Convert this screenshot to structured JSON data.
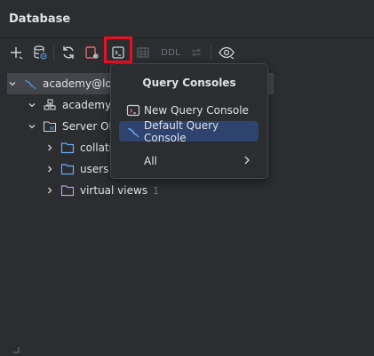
{
  "panel": {
    "title": "Database"
  },
  "toolbar": {
    "ddl_label": "DDL"
  },
  "tree": {
    "root": {
      "label": "academy@lo"
    },
    "schema": {
      "label": "academy"
    },
    "server_objects": {
      "label": "Server Ob"
    },
    "children": [
      {
        "label": "collatio",
        "count": ""
      },
      {
        "label": "users",
        "count": ""
      },
      {
        "label": "virtual views",
        "count": "1"
      }
    ]
  },
  "popup": {
    "title": "Query Consoles",
    "items": [
      {
        "label": "New Query Console",
        "icon": "console-icon"
      },
      {
        "label": "Default Query Console",
        "icon": "mysql-dolphin-icon",
        "active": true
      },
      {
        "label": "All",
        "icon": "chevron-right-icon"
      }
    ]
  },
  "colors": {
    "background": "#2b2d30",
    "selection": "#43454a",
    "menu_active": "#2e436e",
    "highlight": "#e81123",
    "dolphin": "#4f8fd6",
    "folder_blue": "#6aa9ff",
    "folder_purple": "#b39ddb"
  }
}
